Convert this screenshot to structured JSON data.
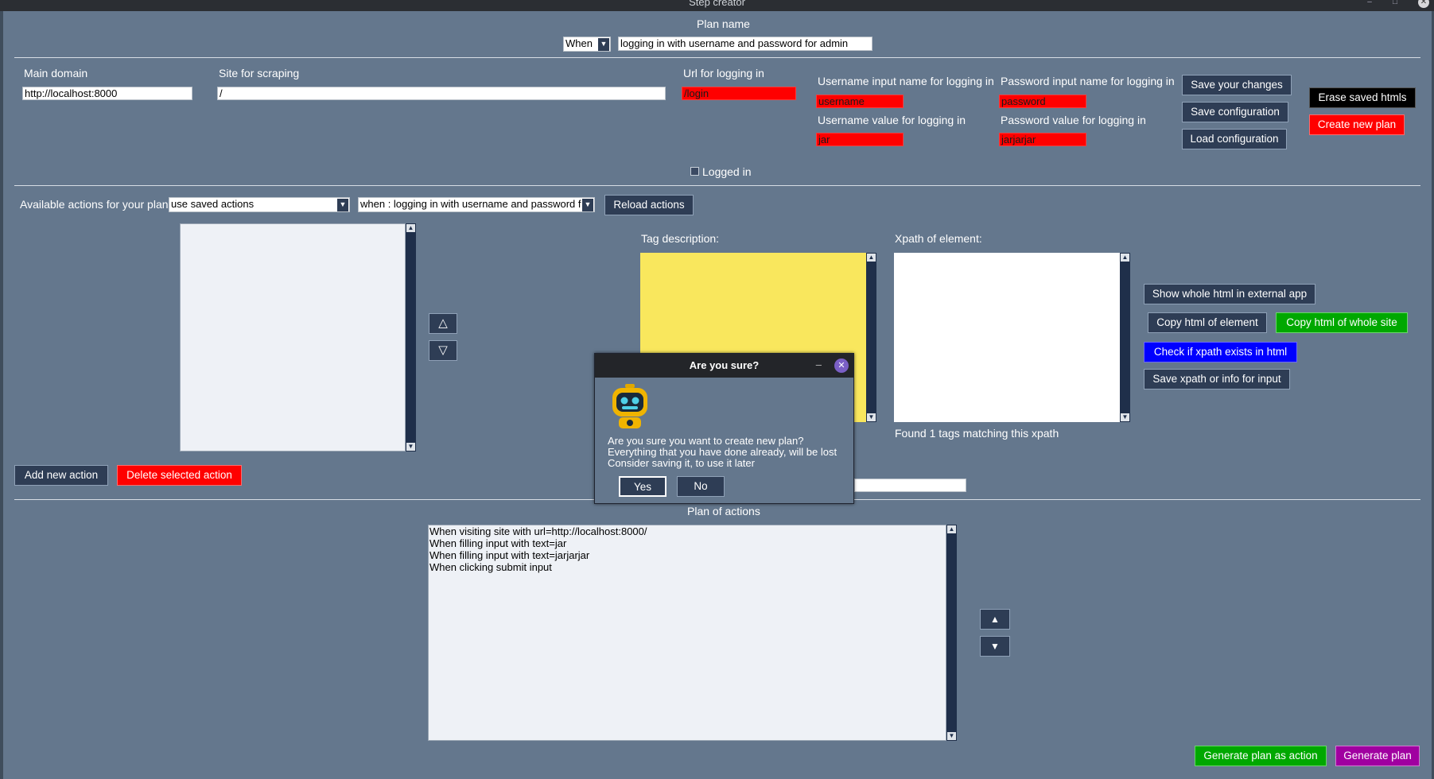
{
  "window": {
    "title": "Step creator"
  },
  "plan_name": {
    "label": "Plan name",
    "prefix_value": "When",
    "value": "logging in with username and password for admin"
  },
  "config": {
    "main_domain_label": "Main domain",
    "main_domain_value": "http://localhost:8000",
    "site_label": "Site for scraping",
    "site_value": "/",
    "login_url_label": "Url for logging in",
    "login_url_value": "/login",
    "username_input_label": "Username input name for logging in",
    "username_input_value": "username",
    "username_value_label": "Username value for logging in",
    "username_value_value": "jar",
    "password_input_label": "Password input name for logging in",
    "password_input_value": "password",
    "password_value_label": "Password value for logging in",
    "password_value_value": "jarjarjar",
    "logged_in_label": "Logged in"
  },
  "buttons": {
    "save_changes": "Save your changes",
    "save_config": "Save configuration",
    "load_config": "Load configuration",
    "erase_htmls": "Erase saved htmls",
    "create_plan": "Create new plan",
    "reload_actions": "Reload actions",
    "add_action": "Add new action",
    "delete_action": "Delete selected action",
    "show_html": "Show whole html in external app",
    "copy_element": "Copy html of element",
    "copy_site": "Copy html of whole site",
    "check_xpath": "Check if xpath exists in html",
    "save_xpath": "Save xpath or info for input",
    "generate_action": "Generate plan as action",
    "generate_plan": "Generate plan",
    "move_up_hollow": "△",
    "move_down_hollow": "▽",
    "move_up_solid": "▲",
    "move_down_solid": "▼"
  },
  "actions": {
    "label": "Available actions for your plan",
    "source_value": "use saved actions",
    "selected_value": "when : logging in with username and password f"
  },
  "element": {
    "tag_label": "Tag description:",
    "xpath_label": "Xpath of element:",
    "found_text": "Found 1 tags matching this xpath"
  },
  "plan": {
    "label": "Plan of actions",
    "lines": [
      "When visiting site with url=http://localhost:8000/",
      "When filling input with text=jar",
      "When filling input with text=jarjarjar",
      "When clicking submit input"
    ]
  },
  "dialog": {
    "title": "Are you sure?",
    "line1": "Are you sure you want to create new plan?",
    "line2": "Everything that you have done already, will be lost",
    "line3": "Consider saving it, to use it later",
    "yes": "Yes",
    "no": "No",
    "icon": "robot-icon"
  },
  "colors": {
    "background": "#64778d",
    "button": "#2e3d55",
    "required_field": "#ff0000",
    "tag_description": "#f9e75d"
  }
}
